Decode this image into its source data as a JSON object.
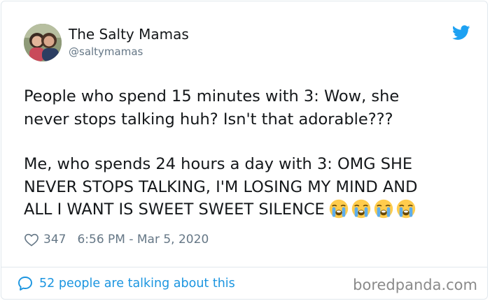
{
  "tweet": {
    "display_name": "The Salty Mamas",
    "handle": "@saltymamas",
    "lines_part1": [
      "People who spend 15 minutes with 3: Wow, she",
      "never stops talking huh? Isn't that adorable???"
    ],
    "lines_part2": [
      "Me, who spends 24 hours a day with 3: OMG SHE",
      "NEVER STOPS TALKING, I'M LOSING MY MIND AND",
      "ALL I WANT IS SWEET SWEET SILENCE"
    ],
    "emoji": [
      "loudly-crying-face",
      "loudly-crying-face",
      "loudly-crying-face",
      "loudly-crying-face"
    ],
    "like_count": "347",
    "timestamp": "6:56 PM - Mar 5, 2020",
    "conversation_text": "52 people are talking about this"
  },
  "brand": {
    "watermark": "boredpanda.com",
    "twitter_blue": "#1da1f2",
    "link_blue": "#1b95e0",
    "muted_gray": "#657786"
  },
  "icons": [
    "twitter-bird-icon",
    "heart-icon",
    "speech-bubble-icon"
  ]
}
